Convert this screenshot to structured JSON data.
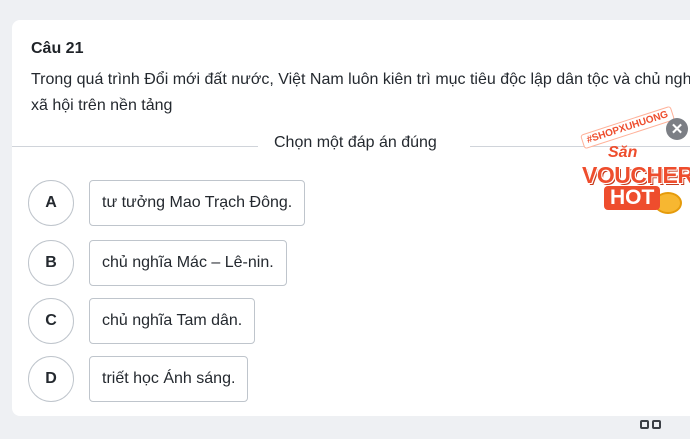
{
  "question": {
    "title": "Câu 21",
    "text": "Trong quá trình Đổi mới đất nước, Việt Nam luôn kiên trì mục tiêu độc lập dân tộc và chủ nghĩa xã hội trên nền tảng"
  },
  "instruction": "Chọn một đáp án đúng",
  "options": [
    {
      "letter": "A",
      "text": "tư tưởng Mao Trạch Đông."
    },
    {
      "letter": "B",
      "text": "chủ nghĩa Mác – Lê-nin."
    },
    {
      "letter": "C",
      "text": "chủ nghĩa Tam dân."
    },
    {
      "letter": "D",
      "text": "triết học Ánh sáng."
    }
  ],
  "promo": {
    "tag": "#SHOPXUHUONG",
    "san": "Săn",
    "voucher": "VOUCHER",
    "hot": "HOT",
    "close_icon": "close-icon"
  },
  "colors": {
    "brand": "#ee4d2d",
    "border": "#bfc5cc"
  }
}
